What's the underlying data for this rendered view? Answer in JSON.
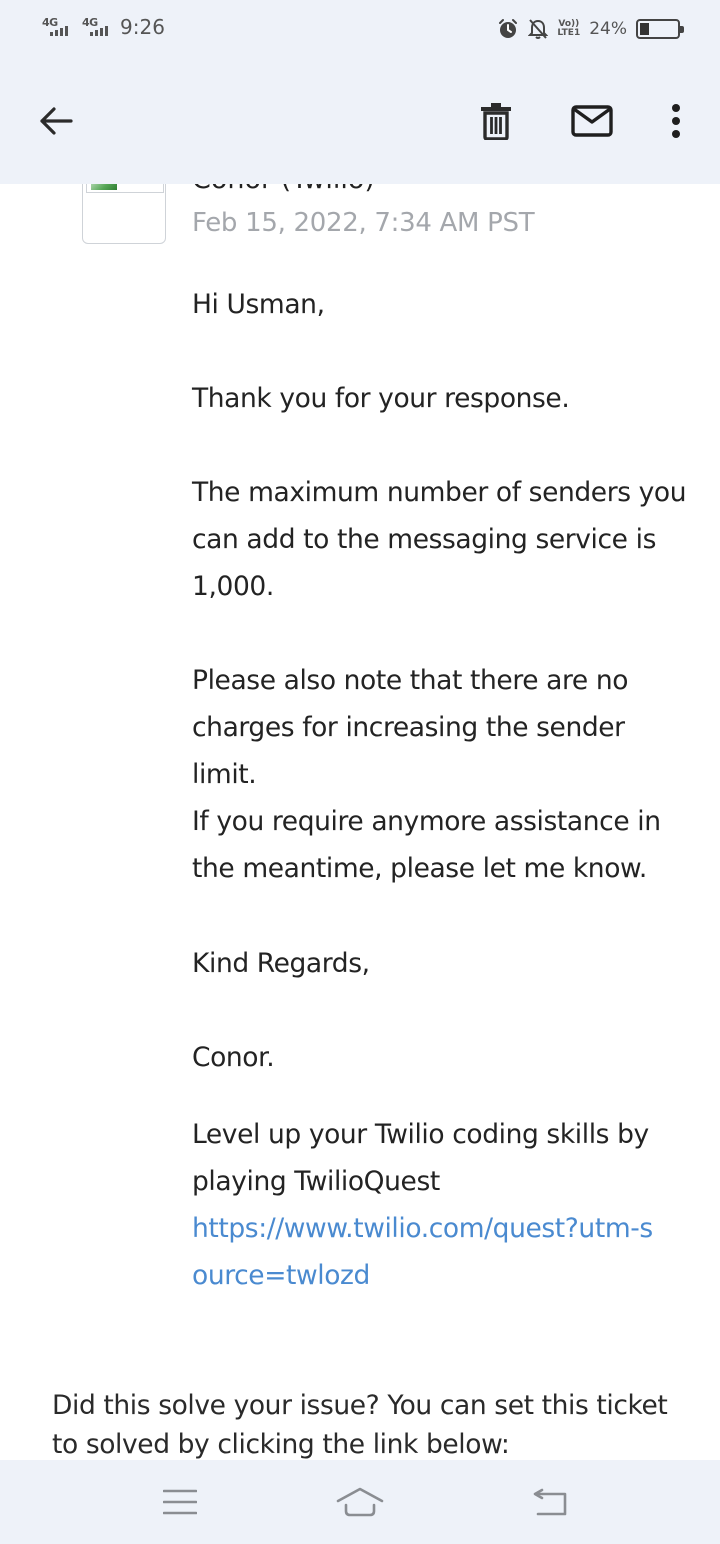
{
  "status_bar": {
    "network_1": "4G",
    "network_2": "4G",
    "time": "9:26",
    "volte_top": "Vo))",
    "volte_bottom": "LTE1",
    "battery_pct": "24%",
    "battery_level": 0.24
  },
  "app_bar": {
    "icons": [
      "arrow-back-icon",
      "trash-icon",
      "mail-icon",
      "more-vert-icon"
    ]
  },
  "message": {
    "sender": "Conor (Twilio)",
    "date": "Feb 15, 2022, 7:34 AM PST",
    "greeting": "Hi Usman,",
    "p1": "Thank you for your response.",
    "p2": "The maximum number of senders you can add to the messaging service is 1,000.",
    "p3": "Please also note that there are no charges for increasing the sender limit.",
    "p4": "If you require anymore assistance in the meantime, please let me know.",
    "closing": "Kind Regards,",
    "signature": "Conor.",
    "promo": "Level up your Twilio coding skills by playing TwilioQuest",
    "promo_link": "https://www.twilio.com/quest?utm-source=twlozd"
  },
  "footer": {
    "note": "Did this solve your issue? You can set this ticket to solved by clicking the link below:"
  },
  "nav_bar": {
    "icons": [
      "menu-icon",
      "home-icon",
      "back-icon"
    ]
  },
  "colors": {
    "bar_bg": "#eef2f9",
    "link": "#4a8ad0",
    "date": "#a4a7ac"
  }
}
